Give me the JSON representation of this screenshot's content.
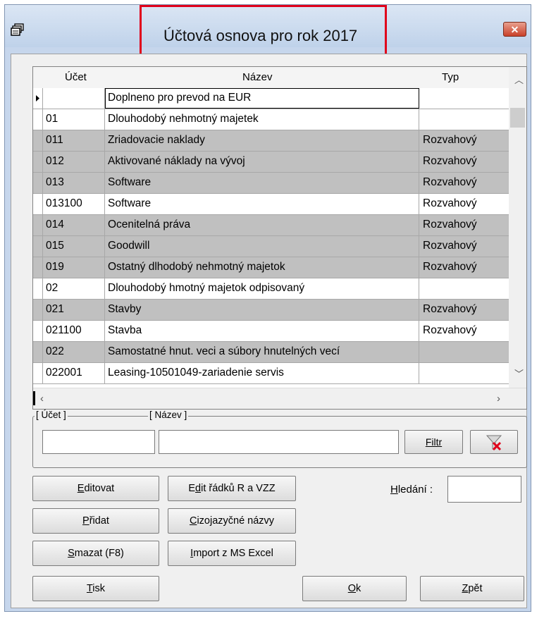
{
  "window": {
    "title": "Účtová osnova pro rok 2017",
    "close_label": "✕"
  },
  "grid": {
    "columns": [
      "Účet",
      "Název",
      "Typ"
    ],
    "rows": [
      {
        "ucet": "",
        "nazev": "Doplneno pro prevod na EUR",
        "typ": "",
        "shade": "white"
      },
      {
        "ucet": "01",
        "nazev": "Dlouhodobý nehmotný majetek",
        "typ": "",
        "shade": "white"
      },
      {
        "ucet": "011",
        "nazev": "Zriadovacie naklady",
        "typ": "Rozvahový",
        "shade": "gray"
      },
      {
        "ucet": "012",
        "nazev": "Aktivované náklady na vývoj",
        "typ": "Rozvahový",
        "shade": "gray"
      },
      {
        "ucet": "013",
        "nazev": "Software",
        "typ": "Rozvahový",
        "shade": "gray"
      },
      {
        "ucet": "013100",
        "nazev": "Software",
        "typ": "Rozvahový",
        "shade": "white"
      },
      {
        "ucet": "014",
        "nazev": "Ocenitelná práva",
        "typ": "Rozvahový",
        "shade": "gray"
      },
      {
        "ucet": "015",
        "nazev": "Goodwill",
        "typ": "Rozvahový",
        "shade": "gray"
      },
      {
        "ucet": "019",
        "nazev": "Ostatný dlhodobý nehmotný majetok",
        "typ": "Rozvahový",
        "shade": "gray"
      },
      {
        "ucet": "02",
        "nazev": "Dlouhodobý hmotný majetok odpisovaný",
        "typ": "",
        "shade": "white"
      },
      {
        "ucet": "021",
        "nazev": "Stavby",
        "typ": "Rozvahový",
        "shade": "gray"
      },
      {
        "ucet": "021100",
        "nazev": "Stavba",
        "typ": "Rozvahový",
        "shade": "white"
      },
      {
        "ucet": "022",
        "nazev": "Samostatné hnut. veci a súbory hnutelných vecí",
        "typ": "",
        "shade": "gray"
      },
      {
        "ucet": "022001",
        "nazev": "Leasing-10501049-zariadenie servis",
        "typ": "",
        "shade": "white"
      }
    ]
  },
  "filter": {
    "ucet_label": "[ Účet ]",
    "nazev_label": "[ Název ]",
    "ucet_value": "",
    "nazev_value": "",
    "filtr_label": "Filtr"
  },
  "buttons": {
    "editovat": "Editovat",
    "edit_radku": "Edit řádků R a VZZ",
    "pridat": "Přidat",
    "cizojazycne": "Cizojazyčné názvy",
    "smazat": "Smazat (F8)",
    "import": "Import z MS Excel",
    "tisk": "Tisk",
    "ok": "Ok",
    "zpet": "Zpět"
  },
  "search": {
    "label": "Hledání :",
    "value": ""
  },
  "colors": {
    "title_highlight": "#e0001b",
    "row_gray": "#c0c0c0"
  }
}
